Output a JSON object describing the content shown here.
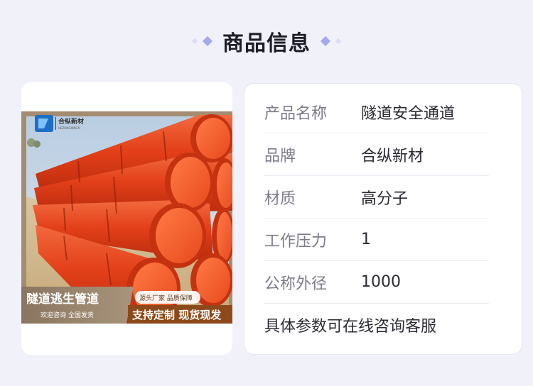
{
  "header": {
    "title": "商品信息"
  },
  "image": {
    "brand_logo_text": "合纵新材",
    "brand_logo_sub": "HEZONGXINCAI",
    "banner_title": "隧道逃生管道",
    "banner_sub": "欢迎咨询 全国发货",
    "tag_pill": "源头厂家 品质保障",
    "slogan": "支持定制 现货现发"
  },
  "specs": [
    {
      "label": "产品名称",
      "value": "隧道安全通道"
    },
    {
      "label": "品牌",
      "value": "合纵新材"
    },
    {
      "label": "材质",
      "value": "高分子"
    },
    {
      "label": "工作压力",
      "value": "1"
    },
    {
      "label": "公称外径",
      "value": "1000"
    }
  ],
  "note": "具体参数可在线咨询客服",
  "colors": {
    "accent": "#a6a8ee",
    "pipe": "#e6401c",
    "page_bg": "#f1f1f9"
  }
}
